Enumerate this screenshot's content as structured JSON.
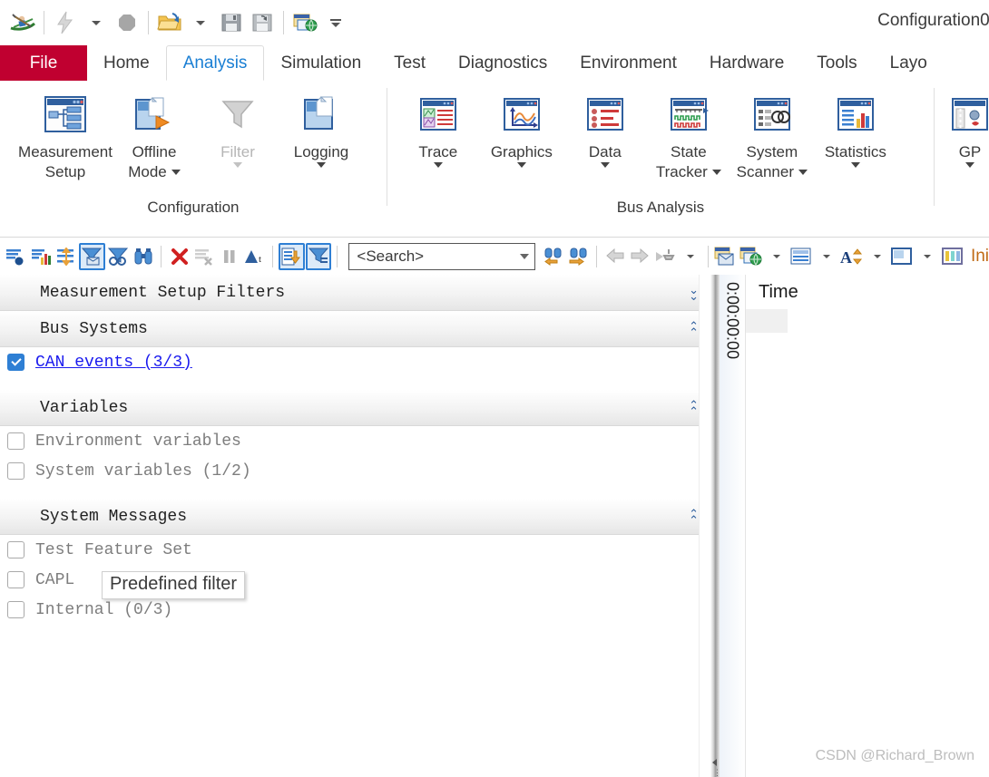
{
  "window": {
    "title": "Configuration0."
  },
  "quick_access": {
    "items": [
      {
        "name": "canoe-logo-icon",
        "label": "CANoe"
      },
      {
        "name": "flash-icon",
        "label": "Flash"
      },
      {
        "name": "flash-dropdown-caret",
        "label": "Flash options"
      },
      {
        "name": "stop-icon",
        "label": "Stop"
      },
      {
        "name": "open-folder-icon",
        "label": "Open Configuration"
      },
      {
        "name": "open-dropdown-caret",
        "label": "Open recent"
      },
      {
        "name": "save-icon",
        "label": "Save"
      },
      {
        "name": "save-as-icon",
        "label": "Save As"
      },
      {
        "name": "configuration-web-icon",
        "label": "Configuration"
      },
      {
        "name": "customize-qat-caret",
        "label": "Customize Quick Access Toolbar"
      }
    ]
  },
  "ribbon": {
    "tabs": [
      {
        "label": "File",
        "active": false,
        "kind": "file"
      },
      {
        "label": "Home",
        "active": false
      },
      {
        "label": "Analysis",
        "active": true
      },
      {
        "label": "Simulation",
        "active": false
      },
      {
        "label": "Test",
        "active": false
      },
      {
        "label": "Diagnostics",
        "active": false
      },
      {
        "label": "Environment",
        "active": false
      },
      {
        "label": "Hardware",
        "active": false
      },
      {
        "label": "Tools",
        "active": false
      },
      {
        "label": "Layo",
        "active": false
      }
    ],
    "groups": [
      {
        "title": "Configuration",
        "items": [
          {
            "icon": "measurement-setup-icon",
            "line1": "Measurement",
            "line2": "Setup",
            "caret": false,
            "disabled": false
          },
          {
            "icon": "offline-mode-icon",
            "line1": "Offline",
            "line2": "Mode",
            "caret": true,
            "disabled": false
          },
          {
            "icon": "filter-funnel-icon",
            "line1": "Filter",
            "line2": "",
            "caret": true,
            "disabled": true
          },
          {
            "icon": "logging-icon",
            "line1": "Logging",
            "line2": "",
            "caret": true,
            "disabled": false
          }
        ]
      },
      {
        "title": "Bus Analysis",
        "items": [
          {
            "icon": "trace-window-icon",
            "line1": "Trace",
            "line2": "",
            "caret": true,
            "disabled": false
          },
          {
            "icon": "graphics-window-icon",
            "line1": "Graphics",
            "line2": "",
            "caret": true,
            "disabled": false
          },
          {
            "icon": "data-window-icon",
            "line1": "Data",
            "line2": "",
            "caret": true,
            "disabled": false
          },
          {
            "icon": "state-tracker-icon",
            "line1": "State",
            "line2": "Tracker",
            "caret": true,
            "disabled": false
          },
          {
            "icon": "system-scanner-icon",
            "line1": "System",
            "line2": "Scanner",
            "caret": true,
            "disabled": false
          },
          {
            "icon": "statistics-icon",
            "line1": "Statistics",
            "line2": "",
            "caret": true,
            "disabled": false
          }
        ]
      },
      {
        "title": "",
        "items": [
          {
            "icon": "gps-window-icon",
            "line1": "GP",
            "line2": "",
            "caret": true,
            "disabled": false
          }
        ]
      }
    ]
  },
  "filter_toolbar": {
    "buttons": [
      {
        "name": "show-all-messages-icon",
        "selected": false
      },
      {
        "name": "statistics-view-icon",
        "selected": false
      },
      {
        "name": "expand-collapse-icon",
        "selected": false
      },
      {
        "name": "predefined-filter-icon",
        "selected": true
      },
      {
        "name": "analysis-filter-icon",
        "selected": false
      },
      {
        "name": "search-binoculars-icon",
        "selected": false
      },
      {
        "name": "delete-filter-icon",
        "selected": false
      },
      {
        "name": "clear-list-icon",
        "selected": false
      },
      {
        "name": "pause-icon",
        "selected": false
      },
      {
        "name": "marker-text-icon",
        "selected": false
      },
      {
        "name": "apply-filter-down-icon",
        "selected": true
      },
      {
        "name": "filter-config-icon",
        "selected": true
      }
    ],
    "search": {
      "value": "",
      "placeholder": "<Search>"
    },
    "nav_buttons": [
      {
        "name": "find-previous-icon"
      },
      {
        "name": "find-next-icon"
      },
      {
        "name": "back-arrow-icon"
      },
      {
        "name": "forward-arrow-icon"
      },
      {
        "name": "marker-jump-icon"
      },
      {
        "name": "marker-jump-caret"
      }
    ],
    "right_buttons": [
      {
        "name": "configuration-window-icon"
      },
      {
        "name": "configuration-web-icon"
      },
      {
        "name": "web-caret"
      },
      {
        "name": "layout-rows-icon"
      },
      {
        "name": "layout-caret"
      },
      {
        "name": "font-size-icon"
      },
      {
        "name": "font-caret"
      },
      {
        "name": "window-split-icon"
      },
      {
        "name": "split-caret"
      },
      {
        "name": "columns-icon"
      }
    ],
    "init_label": "Ini"
  },
  "filter_panel": {
    "tooltip": "Predefined filter",
    "sections": [
      {
        "title": "Measurement Setup Filters",
        "chevron": "down",
        "rows": []
      },
      {
        "title": "Bus Systems",
        "chevron": "up",
        "rows": [
          {
            "label": "CAN events (3/3)",
            "checked": true,
            "link": true
          }
        ]
      },
      {
        "title": "Variables",
        "chevron": "up",
        "rows": [
          {
            "label": "Environment variables",
            "checked": false,
            "link": false
          },
          {
            "label": "System variables (1/2)",
            "checked": false,
            "link": false
          }
        ]
      },
      {
        "title": "System Messages",
        "chevron": "up",
        "rows": [
          {
            "label": "Test Feature Set",
            "checked": false,
            "link": false
          },
          {
            "label": "CAPL",
            "checked": false,
            "link": false
          },
          {
            "label": "Internal (0/3)",
            "checked": false,
            "link": false
          }
        ]
      }
    ]
  },
  "trace_panel": {
    "time_ruler": "0:00:00:00",
    "column_header": "Time"
  },
  "watermark": "CSDN @Richard_Brown",
  "colors": {
    "file_tab": "#c00030",
    "active_tab_text": "#1a7fd4",
    "selected_toolbar_border": "#2e7fd4",
    "link_text": "#1a1aee",
    "init_label": "#c06a14"
  }
}
